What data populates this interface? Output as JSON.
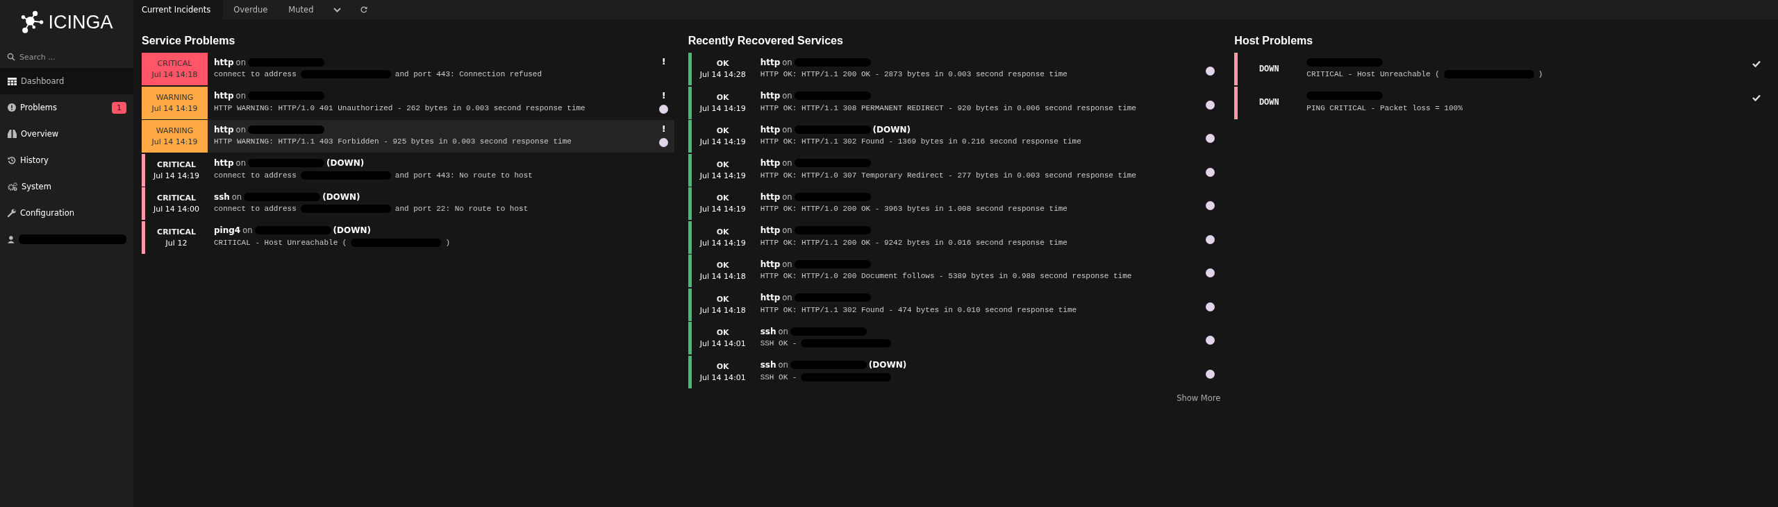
{
  "sidebar": {
    "logo": "ICINGA",
    "search": {
      "placeholder": "Search ..."
    },
    "items": [
      {
        "label": "Dashboard",
        "selected": true
      },
      {
        "label": "Problems",
        "selected": false,
        "badge": "1"
      },
      {
        "label": "Overview",
        "selected": false
      },
      {
        "label": "History",
        "selected": false
      },
      {
        "label": "System",
        "selected": false
      },
      {
        "label": "Configuration",
        "selected": false
      }
    ],
    "user": {
      "redacted": true
    }
  },
  "tabs": [
    {
      "label": "Current Incidents",
      "selected": true
    },
    {
      "label": "Overdue",
      "selected": false
    },
    {
      "label": "Muted",
      "selected": false
    }
  ],
  "service_problems": {
    "title": "Service Problems",
    "rows": [
      {
        "kind": "unhandled",
        "color": "#ff5566",
        "state": "CRITICAL",
        "time": "Jul 14 14:18",
        "service": "http",
        "on": "on",
        "host_redacted": true,
        "output": "connect to address",
        "output_redacted": true,
        "output_suffix": "and port 443: Connection refused",
        "flag": "!",
        "in_progress": false,
        "hovered": false
      },
      {
        "kind": "unhandled",
        "color": "#ffaa44",
        "state": "WARNING",
        "time": "Jul 14 14:19",
        "service": "http",
        "on": "on",
        "host_redacted": true,
        "output": "HTTP WARNING: HTTP/1.0 401 Unauthorized - 262 bytes in 0.003 second response time",
        "output_redacted": false,
        "flag": "!",
        "in_progress": true,
        "hovered": false
      },
      {
        "kind": "unhandled",
        "color": "#ffaa44",
        "state": "WARNING",
        "time": "Jul 14 14:19",
        "service": "http",
        "on": "on",
        "host_redacted": true,
        "output": "HTTP WARNING: HTTP/1.1 403 Forbidden - 925 bytes in 0.003 second response time",
        "output_redacted": false,
        "flag": "!",
        "in_progress": true,
        "hovered": true
      },
      {
        "kind": "handled",
        "color": "#ff99aa",
        "state": "CRITICAL",
        "time": "Jul 14 14:19",
        "service": "http",
        "on": "on",
        "host_redacted": true,
        "host_suffix": "(DOWN)",
        "output": "connect to address",
        "output_redacted": true,
        "output_suffix": "and port 443: No route to host",
        "in_progress": false,
        "hovered": false
      },
      {
        "kind": "handled",
        "color": "#ff99aa",
        "state": "CRITICAL",
        "time": "Jul 14 14:00",
        "service": "ssh",
        "on": "on",
        "host_redacted": true,
        "host_suffix": "(DOWN)",
        "output": "connect to address",
        "output_redacted": true,
        "output_suffix": "and port 22: No route to host",
        "in_progress": false,
        "hovered": false
      },
      {
        "kind": "handled",
        "color": "#ff99aa",
        "state": "CRITICAL",
        "time": "Jul 12",
        "service": "ping4",
        "on": "on",
        "host_redacted": true,
        "host_suffix": "(DOWN)",
        "output": "CRITICAL - Host Unreachable (",
        "output_redacted": true,
        "output_suffix": ")",
        "in_progress": false,
        "hovered": false
      }
    ]
  },
  "recovered_services": {
    "title": "Recently Recovered Services",
    "rows": [
      {
        "kind": "handled",
        "color": "#44bb77",
        "state": "OK",
        "time": "Jul 14 14:28",
        "service": "http",
        "on": "on",
        "host_redacted": true,
        "output": "HTTP OK: HTTP/1.1 200 OK - 2873 bytes in 0.003 second response time",
        "output_redacted": false,
        "in_progress": true,
        "hovered": false
      },
      {
        "kind": "handled",
        "color": "#44bb77",
        "state": "OK",
        "time": "Jul 14 14:19",
        "service": "http",
        "on": "on",
        "host_redacted": true,
        "output": "HTTP OK: HTTP/1.1 308 PERMANENT REDIRECT - 920 bytes in 0.006 second response time",
        "output_redacted": false,
        "in_progress": true,
        "hovered": false
      },
      {
        "kind": "handled",
        "color": "#44bb77",
        "state": "OK",
        "time": "Jul 14 14:19",
        "service": "http",
        "on": "on",
        "host_redacted": true,
        "host_suffix": "(DOWN)",
        "output": "HTTP OK: HTTP/1.1 302 Found - 1369 bytes in 0.216 second response time",
        "output_redacted": false,
        "in_progress": true,
        "hovered": false
      },
      {
        "kind": "handled",
        "color": "#44bb77",
        "state": "OK",
        "time": "Jul 14 14:19",
        "service": "http",
        "on": "on",
        "host_redacted": true,
        "output": "HTTP OK: HTTP/1.0 307 Temporary Redirect - 277 bytes in 0.003 second response time",
        "output_redacted": false,
        "in_progress": true,
        "hovered": false
      },
      {
        "kind": "handled",
        "color": "#44bb77",
        "state": "OK",
        "time": "Jul 14 14:19",
        "service": "http",
        "on": "on",
        "host_redacted": true,
        "output": "HTTP OK: HTTP/1.0 200 OK - 3963 bytes in 1.008 second response time",
        "output_redacted": false,
        "in_progress": true,
        "hovered": false
      },
      {
        "kind": "handled",
        "color": "#44bb77",
        "state": "OK",
        "time": "Jul 14 14:19",
        "service": "http",
        "on": "on",
        "host_redacted": true,
        "output": "HTTP OK: HTTP/1.1 200 OK - 9242 bytes in 0.016 second response time",
        "output_redacted": false,
        "in_progress": true,
        "hovered": false
      },
      {
        "kind": "handled",
        "color": "#44bb77",
        "state": "OK",
        "time": "Jul 14 14:18",
        "service": "http",
        "on": "on",
        "host_redacted": true,
        "output": "HTTP OK: HTTP/1.0 200 Document follows - 5389 bytes in 0.988 second response time",
        "output_redacted": false,
        "in_progress": true,
        "hovered": false
      },
      {
        "kind": "handled",
        "color": "#44bb77",
        "state": "OK",
        "time": "Jul 14 14:18",
        "service": "http",
        "on": "on",
        "host_redacted": true,
        "output": "HTTP OK: HTTP/1.1 302 Found - 474 bytes in 0.010 second response time",
        "output_redacted": false,
        "in_progress": true,
        "hovered": false
      },
      {
        "kind": "handled",
        "color": "#44bb77",
        "state": "OK",
        "time": "Jul 14 14:01",
        "service": "ssh",
        "on": "on",
        "host_redacted": true,
        "output": "SSH OK -",
        "output_redacted": true,
        "in_progress": true,
        "hovered": false
      },
      {
        "kind": "handled",
        "color": "#44bb77",
        "state": "OK",
        "time": "Jul 14 14:01",
        "service": "ssh",
        "on": "on",
        "host_redacted": true,
        "host_suffix": "(DOWN)",
        "output": "SSH OK -",
        "output_redacted": true,
        "in_progress": true,
        "hovered": false
      }
    ],
    "show_more": "Show More"
  },
  "host_problems": {
    "title": "Host Problems",
    "rows": [
      {
        "kind": "handled",
        "color": "#ff99aa",
        "state": "DOWN",
        "host_redacted": true,
        "output": "CRITICAL - Host Unreachable (",
        "output_redacted": true,
        "output_suffix": ")",
        "acknowledged": true,
        "hovered": false
      },
      {
        "kind": "handled",
        "color": "#ff99aa",
        "state": "DOWN",
        "host_redacted": true,
        "output": "PING CRITICAL - Packet loss = 100%",
        "output_redacted": false,
        "acknowledged": true,
        "hovered": false
      }
    ]
  }
}
